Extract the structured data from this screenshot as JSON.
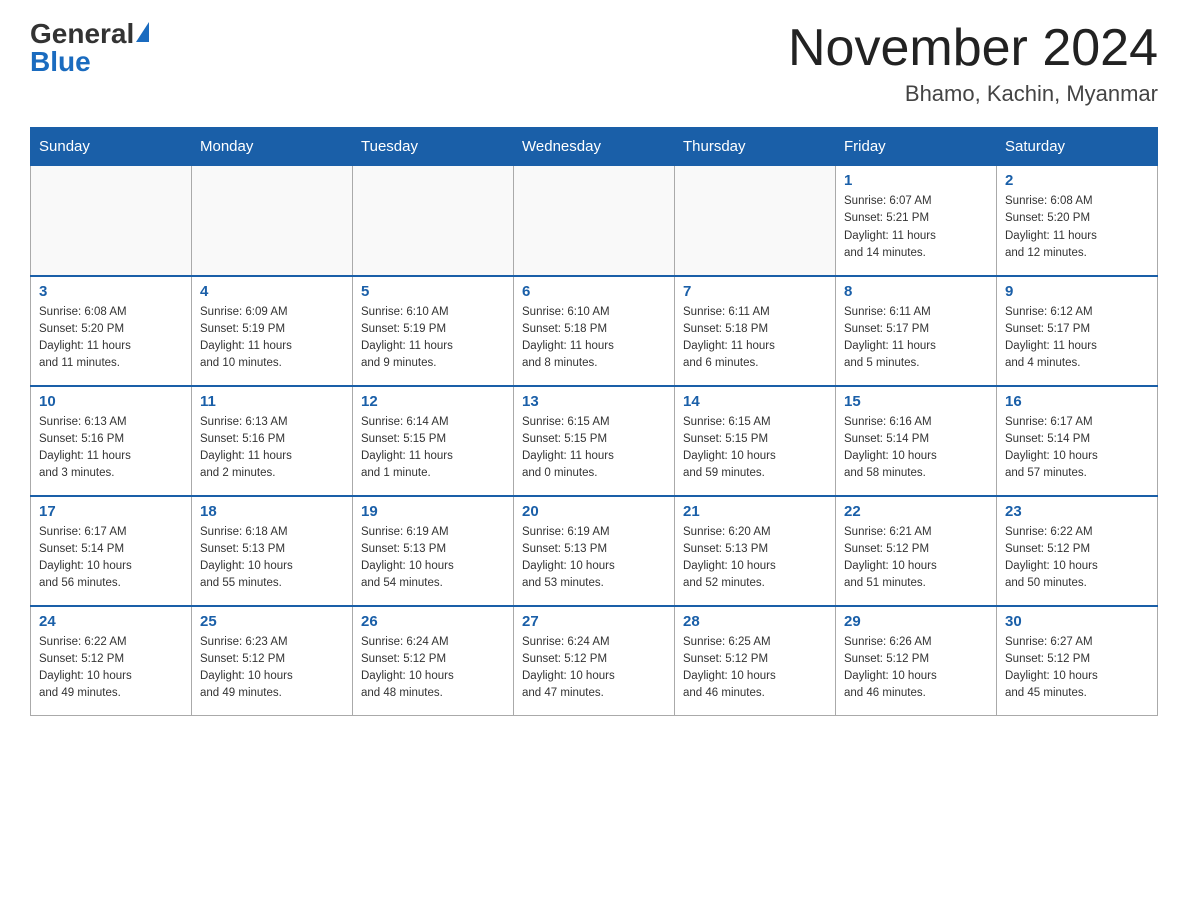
{
  "header": {
    "logo_general": "General",
    "logo_blue": "Blue",
    "month_title": "November 2024",
    "location": "Bhamo, Kachin, Myanmar"
  },
  "weekdays": [
    "Sunday",
    "Monday",
    "Tuesday",
    "Wednesday",
    "Thursday",
    "Friday",
    "Saturday"
  ],
  "weeks": [
    [
      {
        "day": "",
        "info": ""
      },
      {
        "day": "",
        "info": ""
      },
      {
        "day": "",
        "info": ""
      },
      {
        "day": "",
        "info": ""
      },
      {
        "day": "",
        "info": ""
      },
      {
        "day": "1",
        "info": "Sunrise: 6:07 AM\nSunset: 5:21 PM\nDaylight: 11 hours\nand 14 minutes."
      },
      {
        "day": "2",
        "info": "Sunrise: 6:08 AM\nSunset: 5:20 PM\nDaylight: 11 hours\nand 12 minutes."
      }
    ],
    [
      {
        "day": "3",
        "info": "Sunrise: 6:08 AM\nSunset: 5:20 PM\nDaylight: 11 hours\nand 11 minutes."
      },
      {
        "day": "4",
        "info": "Sunrise: 6:09 AM\nSunset: 5:19 PM\nDaylight: 11 hours\nand 10 minutes."
      },
      {
        "day": "5",
        "info": "Sunrise: 6:10 AM\nSunset: 5:19 PM\nDaylight: 11 hours\nand 9 minutes."
      },
      {
        "day": "6",
        "info": "Sunrise: 6:10 AM\nSunset: 5:18 PM\nDaylight: 11 hours\nand 8 minutes."
      },
      {
        "day": "7",
        "info": "Sunrise: 6:11 AM\nSunset: 5:18 PM\nDaylight: 11 hours\nand 6 minutes."
      },
      {
        "day": "8",
        "info": "Sunrise: 6:11 AM\nSunset: 5:17 PM\nDaylight: 11 hours\nand 5 minutes."
      },
      {
        "day": "9",
        "info": "Sunrise: 6:12 AM\nSunset: 5:17 PM\nDaylight: 11 hours\nand 4 minutes."
      }
    ],
    [
      {
        "day": "10",
        "info": "Sunrise: 6:13 AM\nSunset: 5:16 PM\nDaylight: 11 hours\nand 3 minutes."
      },
      {
        "day": "11",
        "info": "Sunrise: 6:13 AM\nSunset: 5:16 PM\nDaylight: 11 hours\nand 2 minutes."
      },
      {
        "day": "12",
        "info": "Sunrise: 6:14 AM\nSunset: 5:15 PM\nDaylight: 11 hours\nand 1 minute."
      },
      {
        "day": "13",
        "info": "Sunrise: 6:15 AM\nSunset: 5:15 PM\nDaylight: 11 hours\nand 0 minutes."
      },
      {
        "day": "14",
        "info": "Sunrise: 6:15 AM\nSunset: 5:15 PM\nDaylight: 10 hours\nand 59 minutes."
      },
      {
        "day": "15",
        "info": "Sunrise: 6:16 AM\nSunset: 5:14 PM\nDaylight: 10 hours\nand 58 minutes."
      },
      {
        "day": "16",
        "info": "Sunrise: 6:17 AM\nSunset: 5:14 PM\nDaylight: 10 hours\nand 57 minutes."
      }
    ],
    [
      {
        "day": "17",
        "info": "Sunrise: 6:17 AM\nSunset: 5:14 PM\nDaylight: 10 hours\nand 56 minutes."
      },
      {
        "day": "18",
        "info": "Sunrise: 6:18 AM\nSunset: 5:13 PM\nDaylight: 10 hours\nand 55 minutes."
      },
      {
        "day": "19",
        "info": "Sunrise: 6:19 AM\nSunset: 5:13 PM\nDaylight: 10 hours\nand 54 minutes."
      },
      {
        "day": "20",
        "info": "Sunrise: 6:19 AM\nSunset: 5:13 PM\nDaylight: 10 hours\nand 53 minutes."
      },
      {
        "day": "21",
        "info": "Sunrise: 6:20 AM\nSunset: 5:13 PM\nDaylight: 10 hours\nand 52 minutes."
      },
      {
        "day": "22",
        "info": "Sunrise: 6:21 AM\nSunset: 5:12 PM\nDaylight: 10 hours\nand 51 minutes."
      },
      {
        "day": "23",
        "info": "Sunrise: 6:22 AM\nSunset: 5:12 PM\nDaylight: 10 hours\nand 50 minutes."
      }
    ],
    [
      {
        "day": "24",
        "info": "Sunrise: 6:22 AM\nSunset: 5:12 PM\nDaylight: 10 hours\nand 49 minutes."
      },
      {
        "day": "25",
        "info": "Sunrise: 6:23 AM\nSunset: 5:12 PM\nDaylight: 10 hours\nand 49 minutes."
      },
      {
        "day": "26",
        "info": "Sunrise: 6:24 AM\nSunset: 5:12 PM\nDaylight: 10 hours\nand 48 minutes."
      },
      {
        "day": "27",
        "info": "Sunrise: 6:24 AM\nSunset: 5:12 PM\nDaylight: 10 hours\nand 47 minutes."
      },
      {
        "day": "28",
        "info": "Sunrise: 6:25 AM\nSunset: 5:12 PM\nDaylight: 10 hours\nand 46 minutes."
      },
      {
        "day": "29",
        "info": "Sunrise: 6:26 AM\nSunset: 5:12 PM\nDaylight: 10 hours\nand 46 minutes."
      },
      {
        "day": "30",
        "info": "Sunrise: 6:27 AM\nSunset: 5:12 PM\nDaylight: 10 hours\nand 45 minutes."
      }
    ]
  ]
}
